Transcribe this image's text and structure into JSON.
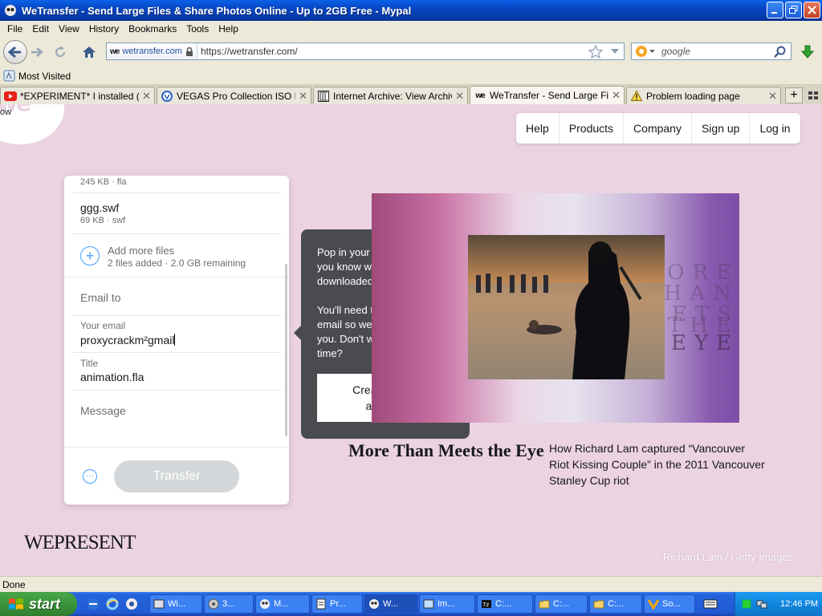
{
  "window": {
    "title": "WeTransfer - Send Large Files & Share Photos Online - Up to 2GB Free - Mypal"
  },
  "menu": [
    "File",
    "Edit",
    "View",
    "History",
    "Bookmarks",
    "Tools",
    "Help"
  ],
  "urlbar": {
    "identity": "wetransfer.com",
    "url": "https://wetransfer.com/"
  },
  "search": {
    "placeholder": "google"
  },
  "bookmarks": {
    "most_visited": "Most Visited"
  },
  "tabs": [
    {
      "label": "*EXPERIMENT* I installed (al...",
      "icon": "youtube-icon"
    },
    {
      "label": "VEGAS Pro Collection ISO Re...",
      "icon": "vegas-icon"
    },
    {
      "label": "Internet Archive: View Archive",
      "icon": "archive-icon"
    },
    {
      "label": "WeTransfer - Send Large File...",
      "icon": "wetransfer-icon",
      "active": true
    },
    {
      "label": "Problem loading page",
      "icon": "warning-icon"
    }
  ],
  "page": {
    "logo_fragment": "ow",
    "nav": [
      "Help",
      "Products",
      "Company",
      "Sign up",
      "Log in"
    ],
    "files": [
      {
        "meta": "245 KB · fla"
      },
      {
        "name": "ggg.swf",
        "meta": "69 KB · swf"
      }
    ],
    "add_more": {
      "title": "Add more files",
      "sub": "2 files added · 2.0 GB remaining"
    },
    "email_to_placeholder": "Email to",
    "your_email": {
      "label": "Your email",
      "value": "proxycrackm²gmail"
    },
    "title_field": {
      "label": "Title",
      "value": "animation.fla"
    },
    "message_placeholder": "Message",
    "options_glyph": "···",
    "transfer_button": "Transfer",
    "tooltip": {
      "p1": "Pop in your email and we'll let you know when your files get downloaded.",
      "p2": "You'll need to verify your email so we know it's really you. Don't want to verify every time?",
      "button": "Create a free account"
    },
    "ad": {
      "title": "More Than Meets the Eye",
      "description": "How Richard Lam captured “Vancouver Riot Kissing Couple” in the 2011 Vancouver Stanley Cup riot",
      "brand": "WEPRESENT",
      "credit": "Richard Lam / Getty Images",
      "art_words": [
        "MORE",
        "THAN",
        "MEETS",
        "THE",
        "EYE"
      ]
    }
  },
  "status": {
    "text": "Done"
  },
  "taskbar": {
    "start": "start",
    "items": [
      "Wi...",
      "3...",
      "M...",
      "Pr...",
      "W...",
      "Im...",
      "C:...",
      "C:...",
      "C:...",
      "So..."
    ],
    "clock": "12:46 PM"
  }
}
